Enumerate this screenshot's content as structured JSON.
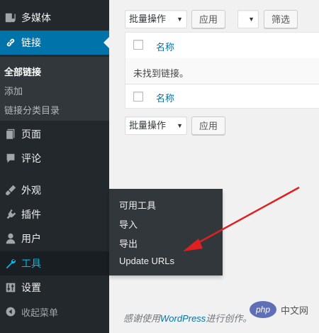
{
  "sidebar": {
    "items": [
      {
        "label": "多媒体",
        "icon": "media-icon"
      },
      {
        "label": "链接",
        "icon": "link-icon"
      },
      {
        "label": "页面",
        "icon": "page-icon"
      },
      {
        "label": "评论",
        "icon": "comment-icon"
      },
      {
        "label": "外观",
        "icon": "appearance-icon"
      },
      {
        "label": "插件",
        "icon": "plugin-icon"
      },
      {
        "label": "用户",
        "icon": "user-icon"
      },
      {
        "label": "工具",
        "icon": "tools-icon"
      },
      {
        "label": "设置",
        "icon": "settings-icon"
      }
    ],
    "links_submenu": [
      "全部链接",
      "添加",
      "链接分类目录"
    ],
    "collapse_label": "收起菜单"
  },
  "tools_flyout": [
    "可用工具",
    "导入",
    "导出",
    "Update URLs"
  ],
  "toolbar_top": {
    "bulk_select": "批量操作",
    "apply": "应用",
    "category_select": "",
    "filter": "筛选"
  },
  "table": {
    "column_name": "名称",
    "empty_message": "未找到链接。"
  },
  "toolbar_bottom": {
    "bulk_select": "批量操作",
    "apply": "应用"
  },
  "footer": {
    "prefix": "感谢使用",
    "link": "WordPress",
    "suffix": "进行创作。"
  },
  "watermark": {
    "badge": "php",
    "text": "中文网"
  },
  "colors": {
    "sidebar_bg": "#23282d",
    "active_bg": "#0073aa",
    "hover_text": "#00b9eb",
    "annotation_arrow": "#e02020"
  }
}
